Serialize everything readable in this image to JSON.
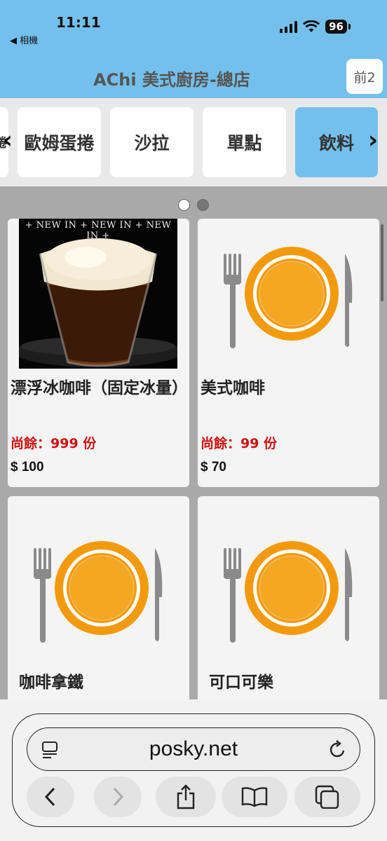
{
  "status": {
    "time": "11:11",
    "back_label": "◀ 相機",
    "battery": "96"
  },
  "header": {
    "title": "AChi 美式廚房-總店",
    "cart_label": "前2"
  },
  "categories": {
    "partial_left": "捲",
    "items": [
      "歐姆蛋捲",
      "沙拉",
      "單點",
      "飲料"
    ],
    "active": "飲料"
  },
  "products": [
    {
      "name": "漂浮冰咖啡（固定冰量）",
      "stock": "尚餘：999 份",
      "price": "$ 100",
      "banner": "+ NEW IN + NEW IN + NEW IN +"
    },
    {
      "name": "美式咖啡",
      "stock": "尚餘：99 份",
      "price": "$ 70"
    },
    {
      "name": "咖啡拿鐵"
    },
    {
      "name": "可口可樂"
    }
  ],
  "browser": {
    "url": "posky.net"
  },
  "colors": {
    "header": "#74c0ec",
    "stock": "#d01010",
    "plate": "#f39a0c"
  }
}
